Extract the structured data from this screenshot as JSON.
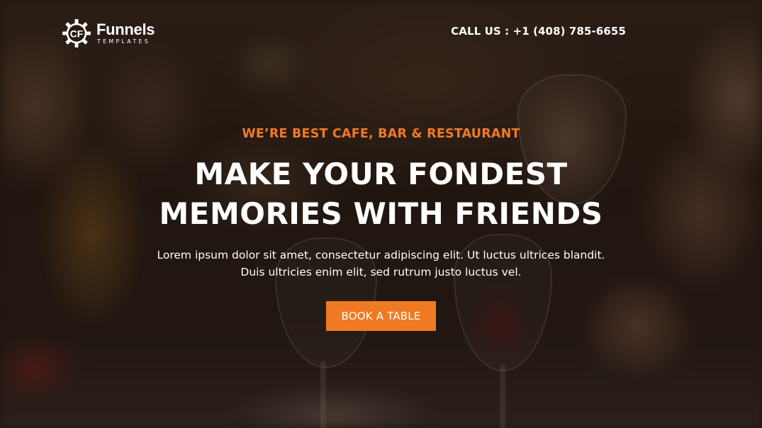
{
  "brand": {
    "name": "Funnels",
    "tagline": "TEMPLATES",
    "icon": "gear-cf-logo-icon"
  },
  "header": {
    "call_text": "CALL US : +1 (408) 785-6655"
  },
  "hero": {
    "eyebrow": "WE’RE BEST CAFE, BAR & RESTAURANT",
    "headline_line1": "MAKE YOUR FONDEST",
    "headline_line2": "MEMORIES WITH FRIENDS",
    "lede_line1": "Lorem ipsum dolor sit amet, consectetur adipiscing elit. Ut luctus ultrices blandit.",
    "lede_line2": "Duis ultricies enim elit, sed rutrum justo luctus vel.",
    "cta_label": "BOOK A TABLE"
  },
  "colors": {
    "accent": "#ef7a23",
    "text": "#ffffff"
  }
}
